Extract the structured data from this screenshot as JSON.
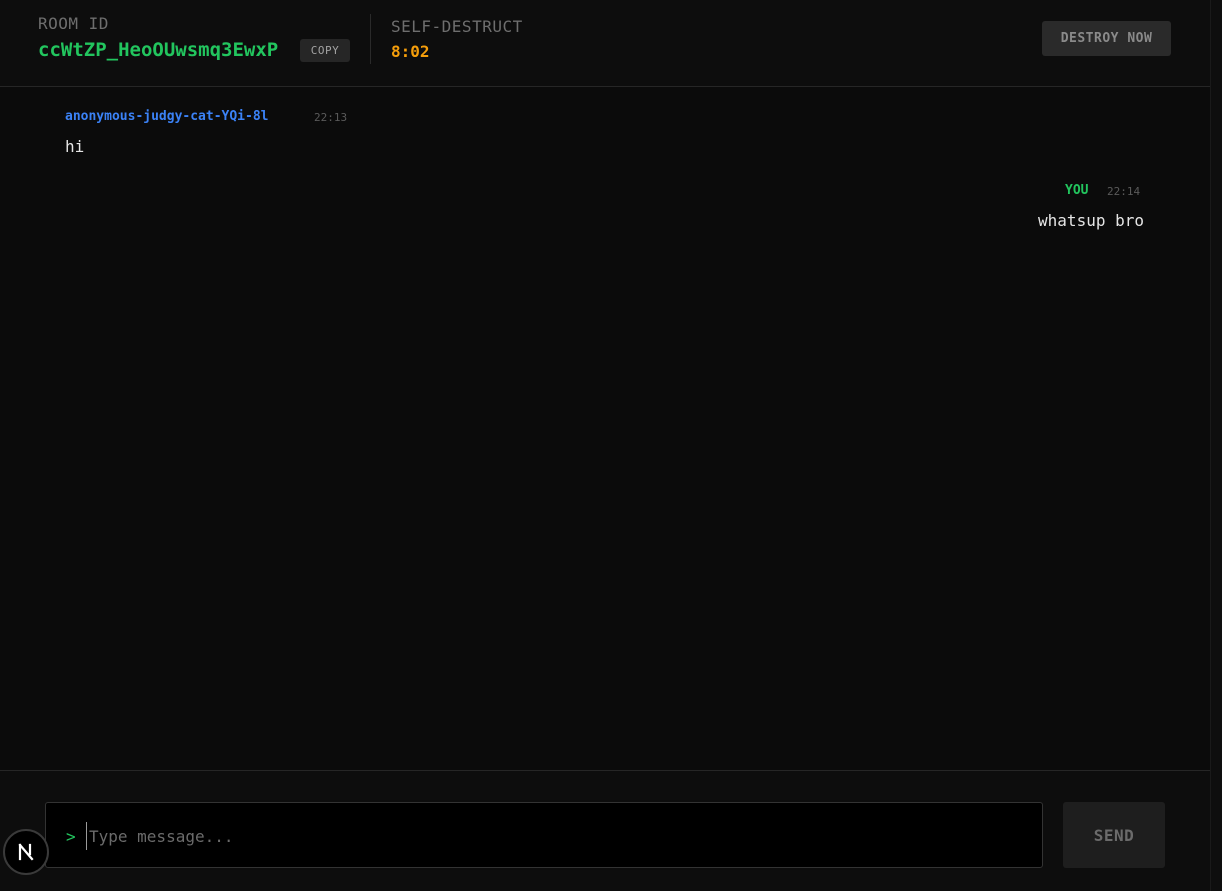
{
  "header": {
    "room_label": "ROOM ID",
    "room_id": "ccWtZP_HeoOUwsmq3EwxP",
    "copy_label": "COPY",
    "self_destruct_label": "SELF-DESTRUCT",
    "self_destruct_timer": "8:02",
    "destroy_label": "DESTROY NOW"
  },
  "messages": [
    {
      "sender": "anonymous-judgy-cat-YQi-8l",
      "time": "22:13",
      "text": "hi"
    },
    {
      "sender": "YOU",
      "time": "22:14",
      "text": "whatsup bro"
    }
  ],
  "composer": {
    "prompt": ">",
    "placeholder": "Type message...",
    "value": "",
    "send_label": "SEND"
  },
  "colors": {
    "accent_green": "#22c55e",
    "accent_blue": "#3b82f6",
    "timer_orange": "#f59e0b",
    "background": "#0b0b0b"
  },
  "icons": {
    "badge": "next-logo-icon"
  }
}
